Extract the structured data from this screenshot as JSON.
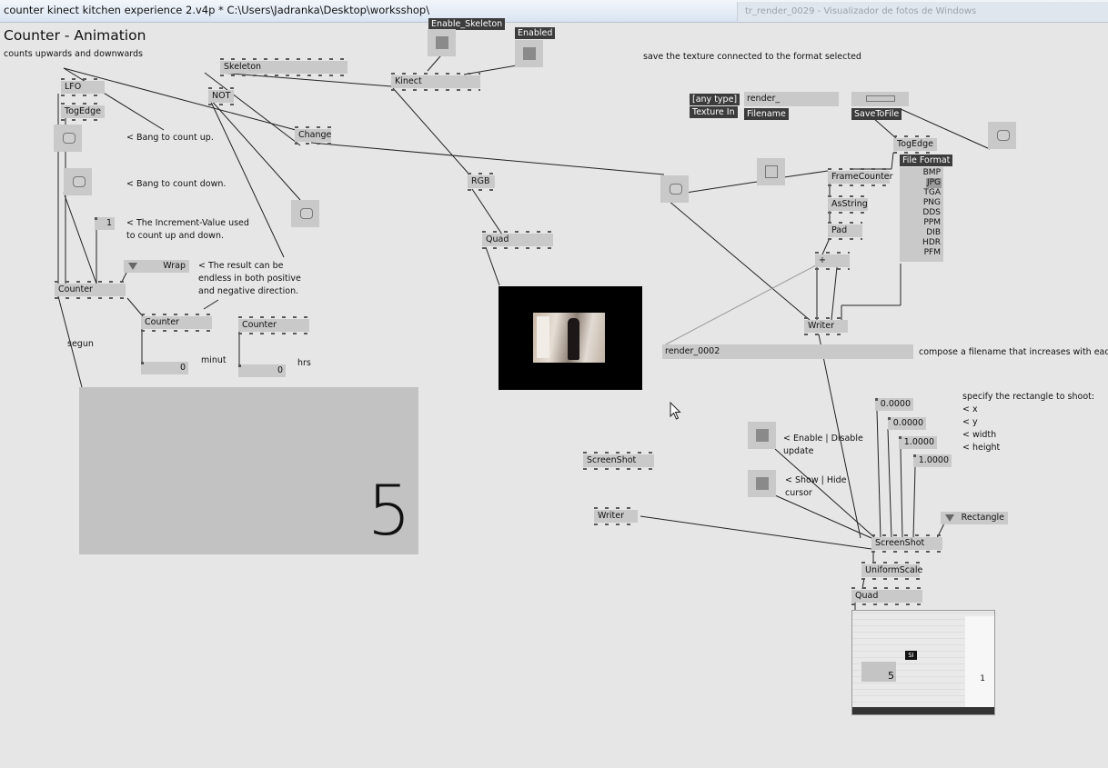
{
  "window": {
    "title": "counter kinect kitchen experience 2.v4p *  C:\\Users\\Jadranka\\Desktop\\worksshop\\",
    "background_window_title": "tr_render_0029 - Visualizador de fotos de Windows"
  },
  "patch": {
    "heading": "Counter - Animation",
    "subheading": "counts upwards and downwards",
    "comments": {
      "bang_up": "< Bang to count up.",
      "bang_down": "< Bang to count down.",
      "increment_1": "< The Increment-Value used",
      "increment_2": "to count up and down.",
      "endless_1": "< The result can be",
      "endless_2": "endless in both positive",
      "endless_3": "and negative direction.",
      "segun": "segun",
      "minut": "minut",
      "hrs": "hrs",
      "save_texture": "save the texture connected to the format selected",
      "compose": "compose a filename that increases with each",
      "enable_1": "< Enable | Disable",
      "enable_2": "update",
      "show_1": "< Show | Hide",
      "show_2": "cursor",
      "rect_0": "specify the rectangle to shoot:",
      "rect_1": "< x",
      "rect_2": "< y",
      "rect_3": "< width",
      "rect_4": "< height"
    },
    "nodes": {
      "lfo": "LFO",
      "togedge_left": "TogEdge",
      "skeleton": "Skeleton",
      "not": "NOT",
      "kinect": "Kinect",
      "change": "Change",
      "rgb": "RGB",
      "quad_top": "Quad",
      "counter_main": "Counter",
      "counter_min": "Counter",
      "counter_hrs": "Counter",
      "togedge_right": "TogEdge",
      "framecounter": "FrameCounter",
      "asstring": "AsString",
      "pad": "Pad",
      "plus": "+",
      "writer_top": "Writer",
      "screenshot_small": "ScreenShot",
      "writer_low": "Writer",
      "screenshot_main": "ScreenShot",
      "uniformscale": "UniformScale",
      "quad_bottom": "Quad"
    },
    "labels": {
      "enable_skeleton": "Enable_Skeleton",
      "enabled": "Enabled",
      "any_type": "[any type]",
      "texture_in": "Texture In",
      "filename": "Filename",
      "savetofile": "SaveToFile",
      "file_format": "File Format"
    },
    "values": {
      "increment": "1",
      "wrap": "Wrap",
      "minutes": "0",
      "hours": "0",
      "render_prefix": "render_",
      "render_name": "render_0002",
      "rect_x": "0.0000",
      "rect_y": "0.0000",
      "rect_w": "1.0000",
      "rect_h": "1.0000",
      "rectangle": "Rectangle",
      "big_counter": "5"
    },
    "formats": [
      "BMP",
      "JPG",
      "TGA",
      "PNG",
      "DDS",
      "PPM",
      "DIB",
      "HDR",
      "PFM"
    ],
    "selected_format": "JPG",
    "preview": {
      "box_label": "SI",
      "counter_value": "5",
      "number_value": "1"
    }
  }
}
